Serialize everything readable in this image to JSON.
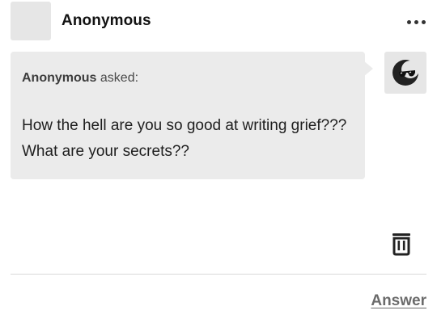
{
  "header": {
    "blog_name": "Anonymous",
    "more_icon": "ellipsis-icon"
  },
  "ask": {
    "asker_name": "Anonymous",
    "asked_suffix": "asked:",
    "question": "How the hell are you so good at writing grief??? What are your secrets??",
    "asker_avatar_icon": "sunglasses-moon-avatar-icon"
  },
  "actions": {
    "delete_icon": "trash-icon",
    "answer_label": "Answer"
  },
  "colors": {
    "bubble": "#ebebeb",
    "avatar_placeholder": "#e6e6e6",
    "answer_link": "#6b6b6b"
  }
}
